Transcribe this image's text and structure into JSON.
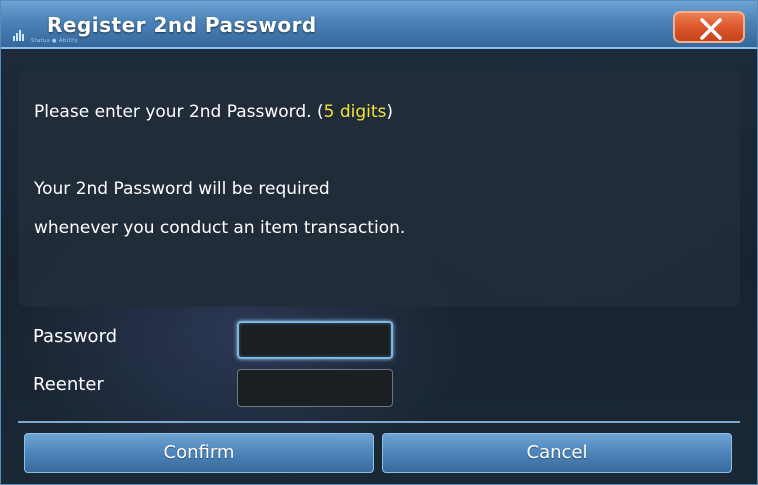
{
  "window": {
    "title": "Register 2nd Password",
    "subtitle": "Status ● Ability",
    "close_icon": "close-x-icon"
  },
  "message": {
    "prompt_prefix": "Please enter your 2nd Password. (",
    "prompt_highlight": "5 digits",
    "prompt_suffix": ")",
    "info_line1": "Your 2nd Password will be required",
    "info_line2": "whenever you conduct an item transaction."
  },
  "form": {
    "password_label": "Password",
    "password_value": "",
    "reenter_label": "Reenter",
    "reenter_value": ""
  },
  "buttons": {
    "confirm_label": "Confirm",
    "cancel_label": "Cancel"
  },
  "colors": {
    "title_bar": "#4b83b8",
    "close_button": "#d9542a",
    "highlight_text": "#f2e23a",
    "button": "#4d84b9"
  }
}
